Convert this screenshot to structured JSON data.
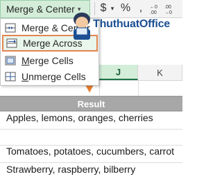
{
  "ribbon": {
    "merge_button_label": "Merge & Center",
    "merge_button_arrow": "▾",
    "currency_symbol": "$",
    "currency_arrow": "▾",
    "percent_symbol": "%",
    "comma_symbol": ","
  },
  "menu": {
    "items": [
      {
        "label": "Merge & Center",
        "icon": "merge-center-icon"
      },
      {
        "label": "Merge Across",
        "icon": "merge-across-icon",
        "highlighted": true
      },
      {
        "label": "Merge Cells",
        "icon": "merge-cells-icon",
        "underline": "M",
        "rest": "erge Cells"
      },
      {
        "label": "Unmerge Cells",
        "icon": "unmerge-cells-icon",
        "underline": "U",
        "rest": "nmerge Cells"
      }
    ]
  },
  "logo": {
    "text": "ThuthuatOffice"
  },
  "sheet": {
    "column_headers": [
      "J",
      "K"
    ],
    "header_row": {
      "label": "Result"
    },
    "rows": [
      "Apples, lemons, oranges, cherries",
      "Tomatoes, potatoes, cucumbers, carrot",
      "Strawberry, raspberry, bilberry"
    ]
  },
  "colors": {
    "accent_orange": "#e97e2f",
    "highlight_green": "#d3edd8",
    "excel_green": "#217346",
    "logo_blue": "#1c4f92",
    "result_header_gray": "#a7a7a7"
  }
}
